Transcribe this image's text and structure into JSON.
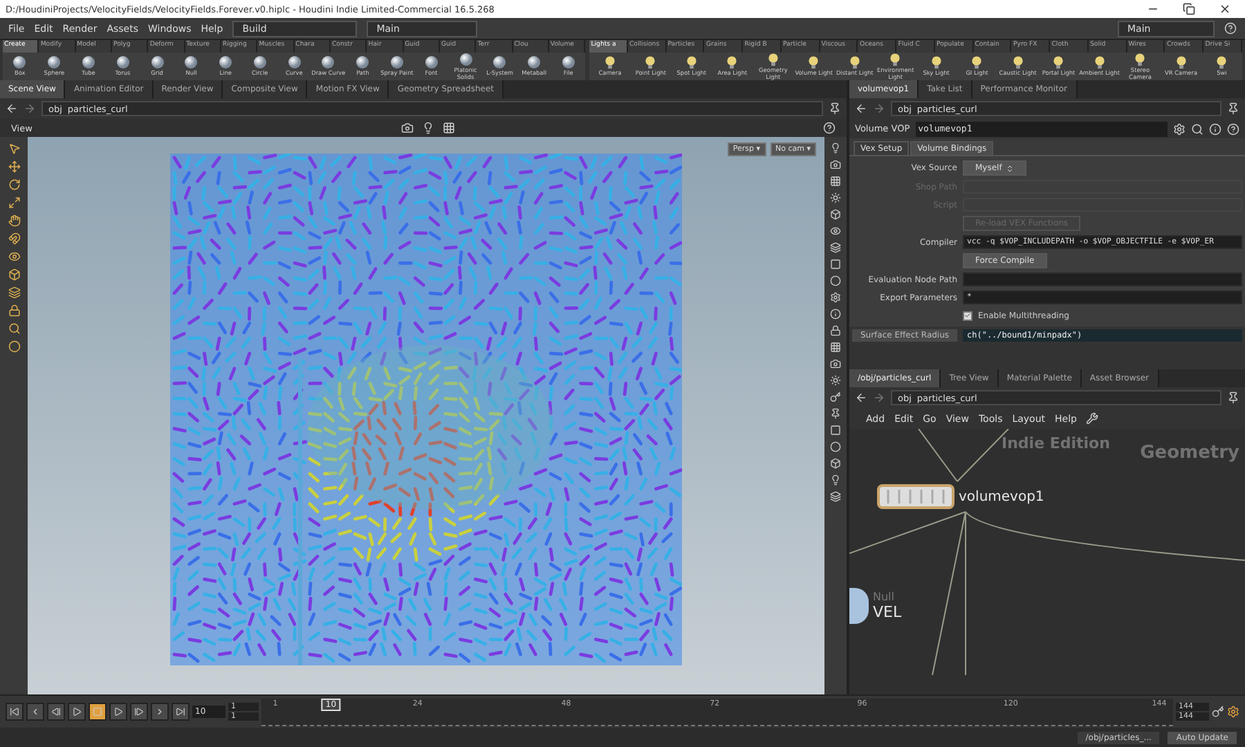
{
  "window": {
    "title": "D:/HoudiniProjects/VelocityFields/VelocityFields.Forever.v0.hiplc - Houdini Indie Limited-Commercial 16.5.268"
  },
  "menu": [
    "File",
    "Edit",
    "Render",
    "Assets",
    "Windows",
    "Help"
  ],
  "desktop": "Build",
  "shelf_set": "Main",
  "right_desktop": "Main",
  "shelves": [
    {
      "kind": "model",
      "tabs": [
        {
          "label": "Create",
          "selected": true
        },
        {
          "label": "Modify",
          "selected": false
        },
        {
          "label": "Model",
          "selected": false
        },
        {
          "label": "Polyg",
          "selected": false
        },
        {
          "label": "Deform",
          "selected": false
        },
        {
          "label": "Texture",
          "selected": false
        },
        {
          "label": "Rigging",
          "selected": false
        },
        {
          "label": "Muscles",
          "selected": false
        },
        {
          "label": "Chara",
          "selected": false
        },
        {
          "label": "Constr",
          "selected": false
        },
        {
          "label": "Hair",
          "selected": false
        },
        {
          "label": "Guid",
          "selected": false
        },
        {
          "label": "Guid",
          "selected": false
        },
        {
          "label": "Terr",
          "selected": false
        },
        {
          "label": "Clou",
          "selected": false
        },
        {
          "label": "Volume",
          "selected": false
        }
      ],
      "tools": [
        "Box",
        "Sphere",
        "Tube",
        "Torus",
        "Grid",
        "Null",
        "Line",
        "Circle",
        "Curve",
        "Draw Curve",
        "Path",
        "Spray Paint",
        "Font",
        "Platonic Solids",
        "L-System",
        "Metaball",
        "File"
      ]
    },
    {
      "kind": "lights",
      "tabs": [
        {
          "label": "Lights a",
          "selected": true
        },
        {
          "label": "Collisions",
          "selected": false
        },
        {
          "label": "Particles",
          "selected": false
        },
        {
          "label": "Grains",
          "selected": false
        },
        {
          "label": "Rigid B",
          "selected": false
        },
        {
          "label": "Particle",
          "selected": false
        },
        {
          "label": "Viscous",
          "selected": false
        },
        {
          "label": "Oceans",
          "selected": false
        },
        {
          "label": "Fluid C",
          "selected": false
        },
        {
          "label": "Populate",
          "selected": false
        },
        {
          "label": "Contain",
          "selected": false
        },
        {
          "label": "Pyro FX",
          "selected": false
        },
        {
          "label": "Cloth",
          "selected": false
        },
        {
          "label": "Solid",
          "selected": false
        },
        {
          "label": "Wires",
          "selected": false
        },
        {
          "label": "Crowds",
          "selected": false
        },
        {
          "label": "Drive Si",
          "selected": false
        }
      ],
      "tools": [
        "Camera",
        "Point Light",
        "Spot Light",
        "Area Light",
        "Geometry Light",
        "Volume Light",
        "Distant Light",
        "Environment Light",
        "Sky Light",
        "GI Light",
        "Caustic Light",
        "Portal Light",
        "Ambient Light",
        "Stereo Camera",
        "VR Camera",
        "Swi"
      ]
    }
  ],
  "scene_pane": {
    "tabs": [
      {
        "label": "Scene View",
        "selected": true
      },
      {
        "label": "Animation Editor",
        "selected": false
      },
      {
        "label": "Render View",
        "selected": false
      },
      {
        "label": "Composite View",
        "selected": false
      },
      {
        "label": "Motion FX View",
        "selected": false
      },
      {
        "label": "Geometry Spreadsheet",
        "selected": false
      }
    ],
    "path": [
      "obj",
      "particles_curl"
    ],
    "view_label": "View",
    "camera_menus": [
      "Persp ▾",
      "No cam ▾"
    ]
  },
  "param_pane": {
    "tabs": [
      {
        "label": "volumevop1",
        "selected": true
      },
      {
        "label": "Take List",
        "selected": false
      },
      {
        "label": "Performance Monitor",
        "selected": false
      }
    ],
    "path": [
      "obj",
      "particles_curl"
    ],
    "node_type": "Volume VOP",
    "node_name": "volumevop1",
    "sub_tabs": [
      {
        "label": "Vex Setup",
        "selected": false
      },
      {
        "label": "Volume Bindings",
        "selected": true
      }
    ],
    "params": [
      {
        "kind": "menu",
        "label": "Vex Source",
        "value": "Myself",
        "disabled": false
      },
      {
        "kind": "field",
        "label": "Shop Path",
        "disabled": true
      },
      {
        "kind": "field",
        "label": "Script",
        "disabled": true
      },
      {
        "kind": "button",
        "label": "Re-load VEX Functions",
        "disabled": true
      },
      {
        "kind": "field",
        "label": "Compiler",
        "value": "vcc -q $VOP_INCLUDEPATH -o $VOP_OBJECTFILE -e $VOP_ER",
        "disabled": false
      },
      {
        "kind": "button",
        "label": "Force Compile",
        "disabled": false
      },
      {
        "kind": "field",
        "label": "Evaluation Node Path",
        "disabled": false
      },
      {
        "kind": "field",
        "label": "Export Parameters",
        "value": "*",
        "disabled": false
      },
      {
        "kind": "checkbox",
        "label": "Enable Multithreading",
        "checked": true,
        "disabled": false
      }
    ],
    "radius": {
      "label": "Surface Effect Radius",
      "value": "ch(\"../bound1/minpadx\")"
    }
  },
  "network_pane": {
    "tabs": [
      {
        "label": "/obj/particles_curl",
        "selected": true
      },
      {
        "label": "Tree View",
        "selected": false
      },
      {
        "label": "Material Palette",
        "selected": false
      },
      {
        "label": "Asset Browser",
        "selected": false
      }
    ],
    "path": [
      "obj",
      "particles_curl"
    ],
    "menu": [
      "Add",
      "Edit",
      "Go",
      "View",
      "Tools",
      "Layout",
      "Help"
    ],
    "watermarks": [
      "Indie Edition",
      "Geometry"
    ],
    "nodes": [
      {
        "kind": "vop",
        "name": "volumevop1"
      },
      {
        "kind": "null",
        "type": "Null",
        "name": "VEL"
      }
    ]
  },
  "timeline": {
    "frame": "10",
    "start": [
      "1",
      "1"
    ],
    "end": [
      "144",
      "144"
    ],
    "stopped": true,
    "ticks": [
      {
        "label": "1",
        "level": 0
      },
      {
        "label": "24",
        "level": 0.161
      },
      {
        "label": "48",
        "level": 0.329
      },
      {
        "label": "72",
        "level": 0.497
      },
      {
        "label": "96",
        "level": 0.664
      },
      {
        "label": "120",
        "level": 0.832
      },
      {
        "label": "144",
        "level": 1
      }
    ],
    "playhead": {
      "label": "10",
      "level": 0.063
    }
  },
  "status_bar": {
    "path": "/obj/particles_...",
    "update": "Auto Update"
  }
}
